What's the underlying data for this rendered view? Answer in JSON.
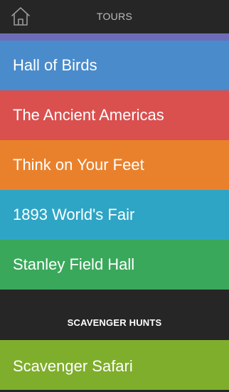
{
  "header": {
    "title": "TOURS",
    "home_icon": "home-icon"
  },
  "top_strip_color": "#6d6db7",
  "tours": [
    {
      "label": "Hall of Birds",
      "color": "#4a8bcb"
    },
    {
      "label": "The Ancient Americas",
      "color": "#d9504f"
    },
    {
      "label": "Think on Your Feet",
      "color": "#e9812c"
    },
    {
      "label": "1893 World's Fair",
      "color": "#2ea5c5"
    },
    {
      "label": "Stanley Field Hall",
      "color": "#3aa85b"
    }
  ],
  "scavenger_hunts": {
    "heading": "SCAVENGER HUNTS",
    "items": [
      {
        "label": "Scavenger Safari",
        "color": "#7fae2c"
      }
    ]
  }
}
